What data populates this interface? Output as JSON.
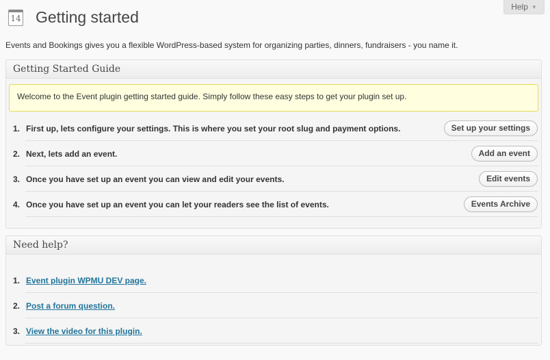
{
  "help_tab": {
    "label": "Help",
    "arrow": "▼"
  },
  "header": {
    "icon_text": "14",
    "title": "Getting started"
  },
  "intro": "Events and Bookings gives you a flexible WordPress-based system for organizing parties, dinners, fundraisers - you name it.",
  "guide": {
    "title": "Getting Started Guide",
    "welcome": "Welcome to the Event plugin getting started guide. Simply follow these easy steps to get your plugin set up.",
    "steps": [
      {
        "num": "1.",
        "text": "First up, lets configure your settings. This is where you set your root slug and payment options.",
        "button": "Set up your settings"
      },
      {
        "num": "2.",
        "text": "Next, lets add an event.",
        "button": "Add an event"
      },
      {
        "num": "3.",
        "text": "Once you have set up an event you can view and edit your events.",
        "button": "Edit events"
      },
      {
        "num": "4.",
        "text": "Once you have set up an event you can let your readers see the list of events.",
        "button": "Events Archive"
      }
    ]
  },
  "help": {
    "title": "Need help?",
    "items": [
      {
        "num": "1.",
        "text": "Event plugin WPMU DEV page."
      },
      {
        "num": "2.",
        "text": "Post a forum question."
      },
      {
        "num": "3.",
        "text": "View the video for this plugin."
      }
    ]
  },
  "colors": {
    "link": "#21759b",
    "welcome_bg": "#ffffe0",
    "welcome_border": "#e6db55"
  }
}
